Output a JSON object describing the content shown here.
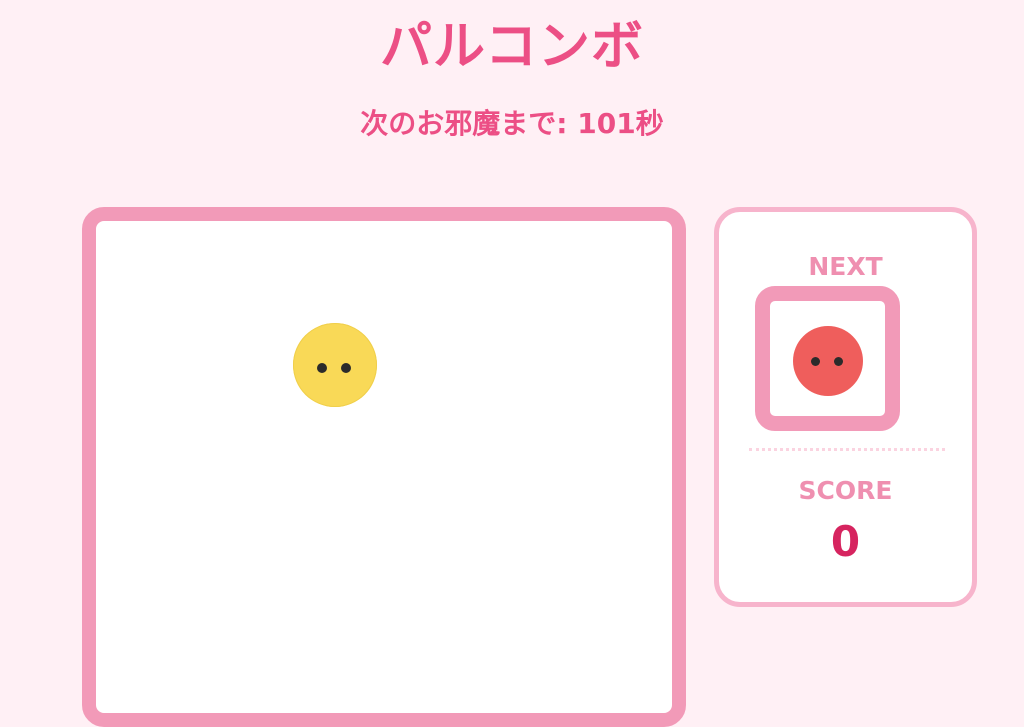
{
  "header": {
    "title": "パルコンボ",
    "timer_text": "次のお邪魔まで: 101秒"
  },
  "board": {
    "falling_piece": {
      "color_name": "yellow",
      "color": "#f9d957",
      "icon": "puyo-face-icon"
    }
  },
  "sidebar": {
    "next_label": "NEXT",
    "next_piece": {
      "color_name": "red",
      "color": "#ef5e5c",
      "icon": "puyo-face-icon"
    },
    "score_label": "SCORE",
    "score_value": "0"
  },
  "theme": {
    "accent": "#ec4f85",
    "frame": "#f29ab8",
    "panel_border": "#f7b4cc",
    "label": "#ef8fb0",
    "score": "#d6245f",
    "background": "#fff0f5"
  }
}
